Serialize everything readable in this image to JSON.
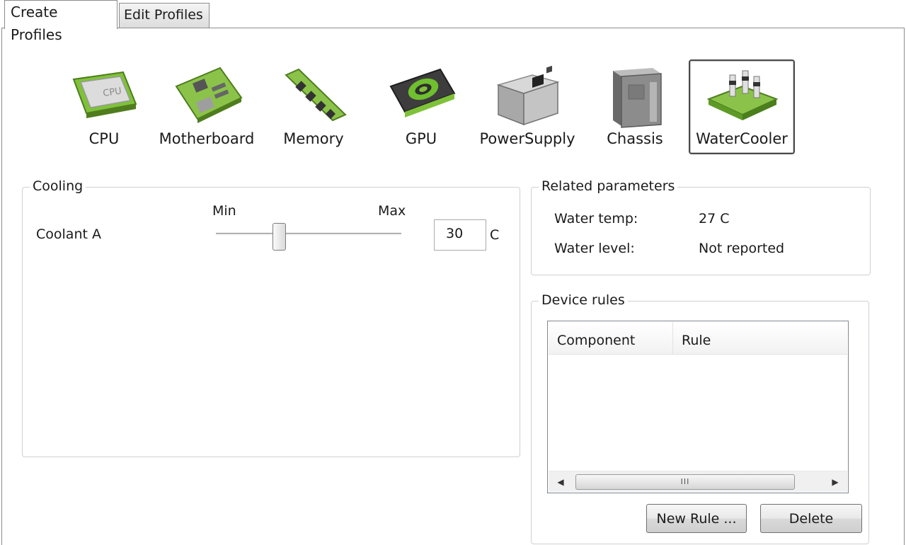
{
  "tabs": [
    {
      "label": "Create Profiles",
      "active": true
    },
    {
      "label": "Edit Profiles",
      "active": false
    }
  ],
  "devices": [
    {
      "label": "CPU",
      "icon": "cpu-icon",
      "selected": false
    },
    {
      "label": "Motherboard",
      "icon": "motherboard-icon",
      "selected": false
    },
    {
      "label": "Memory",
      "icon": "memory-icon",
      "selected": false
    },
    {
      "label": "GPU",
      "icon": "gpu-icon",
      "selected": false
    },
    {
      "label": "PowerSupply",
      "icon": "power-supply-icon",
      "selected": false
    },
    {
      "label": "Chassis",
      "icon": "chassis-icon",
      "selected": false
    },
    {
      "label": "WaterCooler",
      "icon": "water-cooler-icon",
      "selected": true
    }
  ],
  "cooling": {
    "title": "Cooling",
    "row_label": "Coolant A",
    "min_label": "Min",
    "max_label": "Max",
    "slider_position": 0.34,
    "value": "30",
    "unit": "C"
  },
  "related": {
    "title": "Related parameters",
    "rows": [
      {
        "label": "Water temp:",
        "value": "27 C"
      },
      {
        "label": "Water level:",
        "value": "Not reported"
      }
    ]
  },
  "rules": {
    "title": "Device rules",
    "columns": [
      "Component",
      "Rule"
    ],
    "scroll_grip": "III",
    "new_rule_label": "New Rule ...",
    "delete_label": "Delete"
  },
  "colors": {
    "accent_green": "#7fc23a",
    "selection_border": "#4a4a4a"
  }
}
